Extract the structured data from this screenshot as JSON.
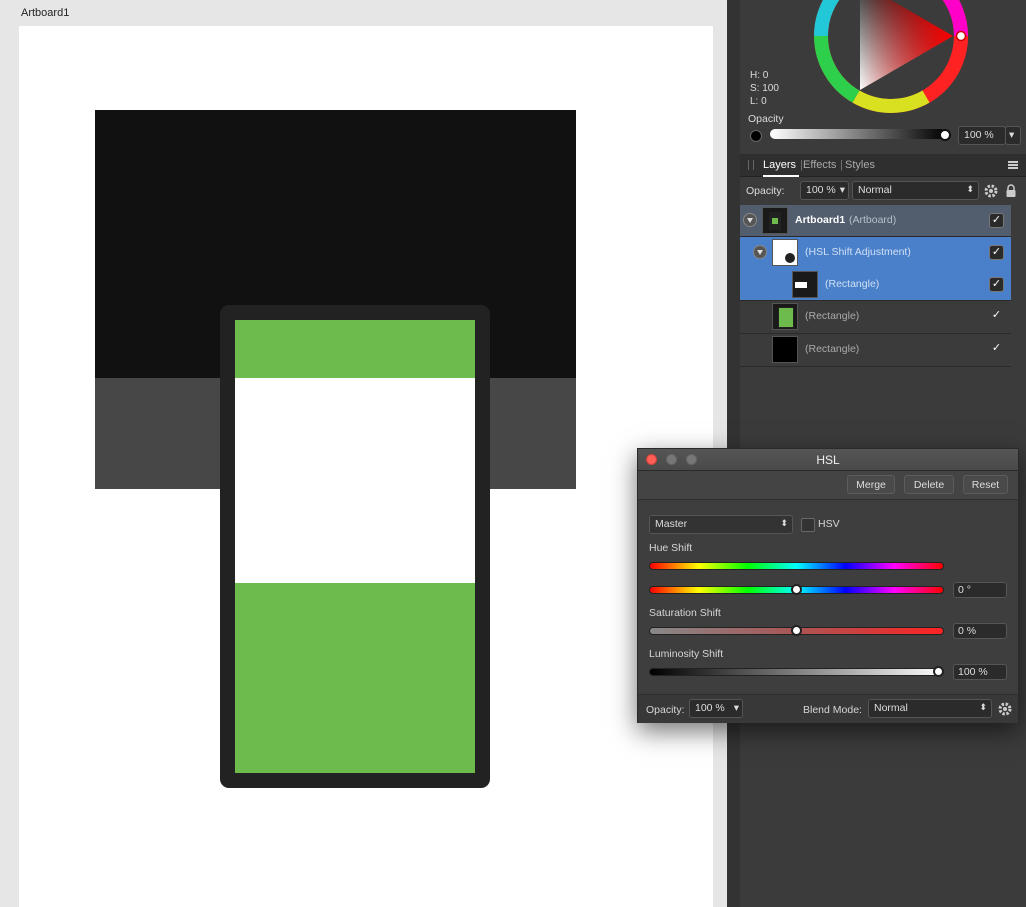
{
  "artboard": {
    "title": "Artboard1"
  },
  "color": {
    "h_label": "H: 0",
    "s_label": "S: 100",
    "l_label": "L: 0",
    "opacity_label": "Opacity",
    "opacity_value": "100 %",
    "opacity_dropdown": "▾"
  },
  "layers_panel": {
    "tabs": [
      "Layers",
      "Effects",
      "Styles"
    ],
    "tab_separator": "|",
    "opacity_label": "Opacity:",
    "opacity_value": "100 %",
    "blend_mode": "Normal",
    "dropdown_arrow": "▾",
    "stepper_arrow": "⬍",
    "layers": [
      {
        "name": "Artboard1",
        "kind": "(Artboard)",
        "checked": "✓"
      },
      {
        "name": "(HSL Shift Adjustment)",
        "checked": "✓"
      },
      {
        "name": "(Rectangle)",
        "checked": "✓"
      },
      {
        "name": "(Rectangle)",
        "checked": "✓"
      },
      {
        "name": "(Rectangle)",
        "checked": "✓"
      }
    ]
  },
  "hsl_dialog": {
    "title": "HSL",
    "merge_label": "Merge",
    "delete_label": "Delete",
    "reset_label": "Reset",
    "channel": "Master",
    "hsv_label": "HSV",
    "hue_label": "Hue Shift",
    "hue_value": "0 °",
    "saturation_label": "Saturation Shift",
    "saturation_value": "0 %",
    "luminosity_label": "Luminosity Shift",
    "luminosity_value": "100 %",
    "hue_shift_fraction": 0.5,
    "saturation_shift_fraction": 0.5,
    "luminosity_shift_fraction": 1.0,
    "opacity_label": "Opacity:",
    "opacity_value": "100 %",
    "blend_mode_label": "Blend Mode:",
    "blend_mode": "Normal"
  },
  "colors": {
    "selection_blue": "#4a7fc9",
    "green": "#6dbb4c",
    "dark_fill": "#111111",
    "gray_fill": "#474747",
    "frame": "#222222"
  }
}
